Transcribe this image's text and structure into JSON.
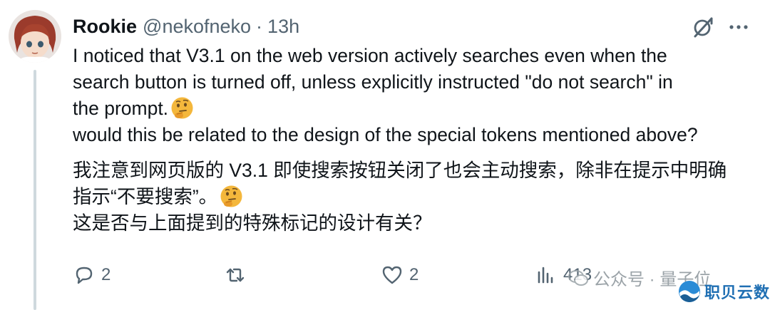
{
  "tweet": {
    "author_name": "Rookie",
    "handle": "@nekofneko",
    "separator": "·",
    "time": "13h",
    "en_line1": "I noticed that V3.1 on the web version actively searches even when the",
    "en_line2": "search button is turned off, unless explicitly instructed \"do not search\" in",
    "en_line3": "the prompt.",
    "en_line4": "would this be related to the design of the special tokens mentioned above?",
    "cn_line1": "我注意到网页版的 V3.1 即使搜索按钮关闭了也会主动搜索，除非在提示中明确",
    "cn_line2": "指示“不要搜索”。",
    "cn_line3": "这是否与上面提到的特殊标记的设计有关？",
    "emoji": "thinking-face"
  },
  "actions": {
    "reply_count": "2",
    "retweet_count": "",
    "like_count": "2",
    "views_count": "413"
  },
  "watermark": {
    "text": "公众号 · 量子位"
  },
  "brand": {
    "text": "职贝云数"
  },
  "colors": {
    "text": "#0f1419",
    "muted": "#536471",
    "thread_line": "#cfd9de",
    "brand": "#1f6fb3"
  }
}
